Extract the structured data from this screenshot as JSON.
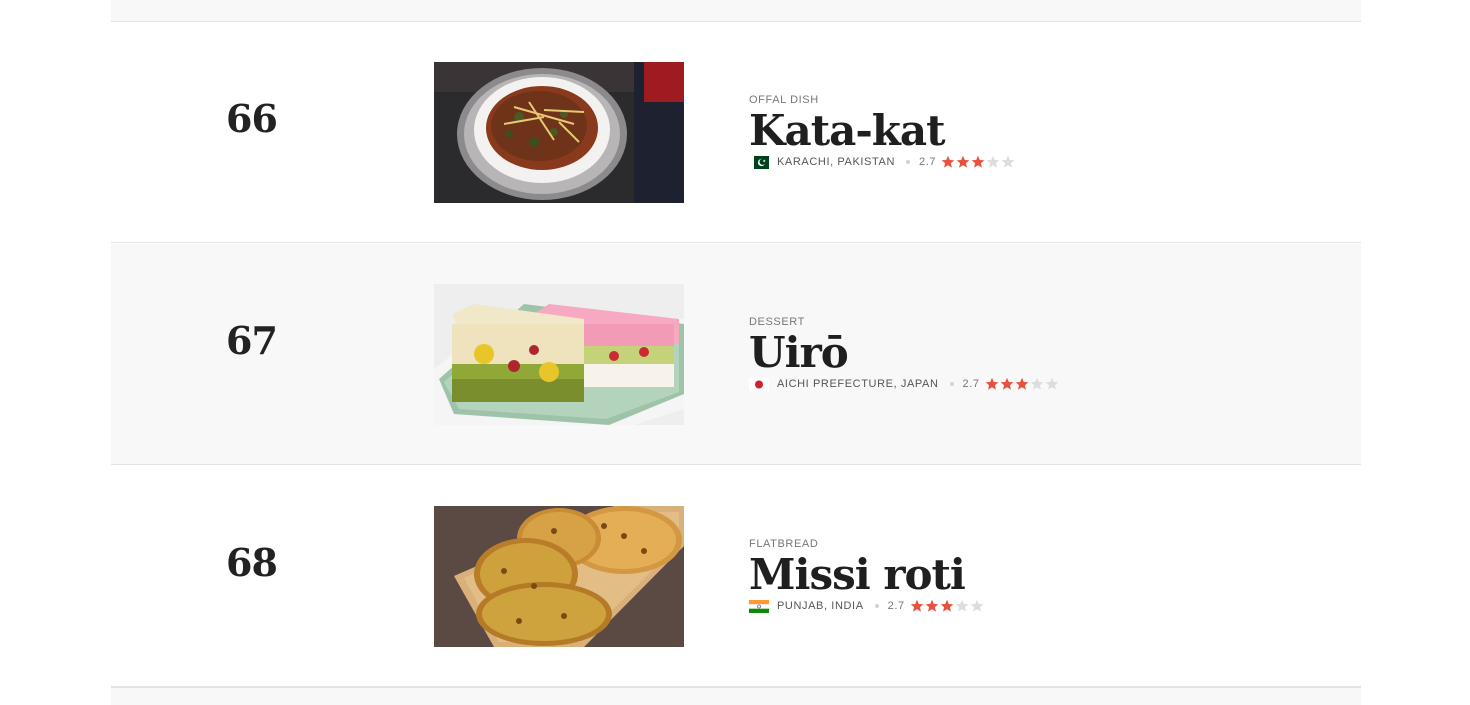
{
  "colors": {
    "star_filled": "#e8513e",
    "star_empty": "#dddddd",
    "row_alt_bg": "#f8f8f8",
    "divider": "#e3e3e3"
  },
  "dishes": [
    {
      "rank": "66",
      "category": "OFFAL DISH",
      "name": "Kata-kat",
      "location": "KARACHI, PAKISTAN",
      "flag_icon": "pakistan-flag-icon",
      "rating": "2.7",
      "stars_filled": 3,
      "stars_total": 5
    },
    {
      "rank": "67",
      "category": "DESSERT",
      "name": "Uirō",
      "location": "AICHI PREFECTURE, JAPAN",
      "flag_icon": "japan-flag-icon",
      "rating": "2.7",
      "stars_filled": 3,
      "stars_total": 5
    },
    {
      "rank": "68",
      "category": "FLATBREAD",
      "name": "Missi roti",
      "location": "PUNJAB, INDIA",
      "flag_icon": "india-flag-icon",
      "rating": "2.7",
      "stars_filled": 3,
      "stars_total": 5
    }
  ]
}
